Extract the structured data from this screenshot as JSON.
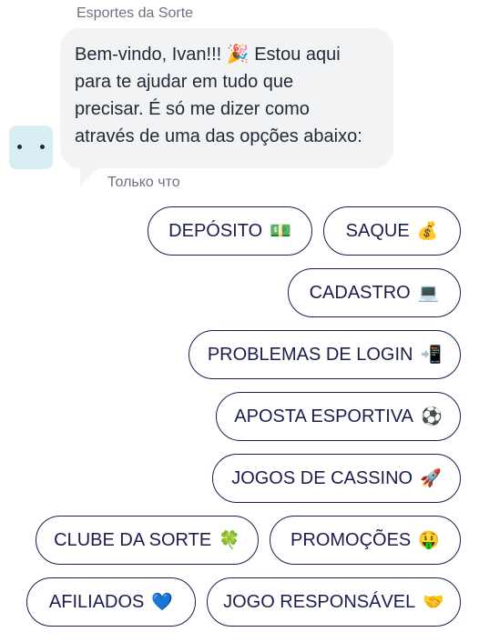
{
  "chat": {
    "sender": "Esportes da Sorte",
    "message": "Bem-vindo, Ivan!!! 🎉 Estou aqui para te ajudar em tudo que precisar. É só me dizer como através de uma das opções abaixo:",
    "message_lines": [
      "Bem-vindo, Ivan!!! 🎉 Estou aqui",
      "para te ajudar em tudo que",
      "precisar. É só me dizer como",
      "através de uma das opções abaixo:"
    ],
    "timestamp": "Только что",
    "avatar_icon": "bot-face-icon"
  },
  "quick_replies": [
    {
      "label": "DEPÓSITO",
      "emoji": "💵",
      "icon": "dollar-banknote-icon"
    },
    {
      "label": "SAQUE",
      "emoji": "💰",
      "icon": "money-bag-icon"
    },
    {
      "label": "CADASTRO",
      "emoji": "💻",
      "icon": "laptop-icon"
    },
    {
      "label": "PROBLEMAS DE LOGIN",
      "emoji": "📲",
      "icon": "mobile-arrow-icon"
    },
    {
      "label": "APOSTA ESPORTIVA",
      "emoji": "⚽",
      "icon": "soccer-ball-icon"
    },
    {
      "label": "JOGOS DE CASSINO",
      "emoji": "🚀",
      "icon": "rocket-icon"
    },
    {
      "label": "CLUBE DA SORTE",
      "emoji": "🍀",
      "icon": "four-leaf-clover-icon"
    },
    {
      "label": "PROMOÇÕES",
      "emoji": "🤑",
      "icon": "money-mouth-face-icon"
    },
    {
      "label": "AFILIADOS",
      "emoji": "💙",
      "icon": "blue-heart-icon"
    },
    {
      "label": "JOGO RESPONSÁVEL",
      "emoji": "🤝",
      "icon": "handshake-icon"
    }
  ],
  "colors": {
    "bubble_bg": "#f2f3f5",
    "button_border": "#1b1e4d",
    "button_text": "#1b1e4d",
    "meta_text": "#6b7280",
    "avatar_bg": "#d8eef2"
  }
}
